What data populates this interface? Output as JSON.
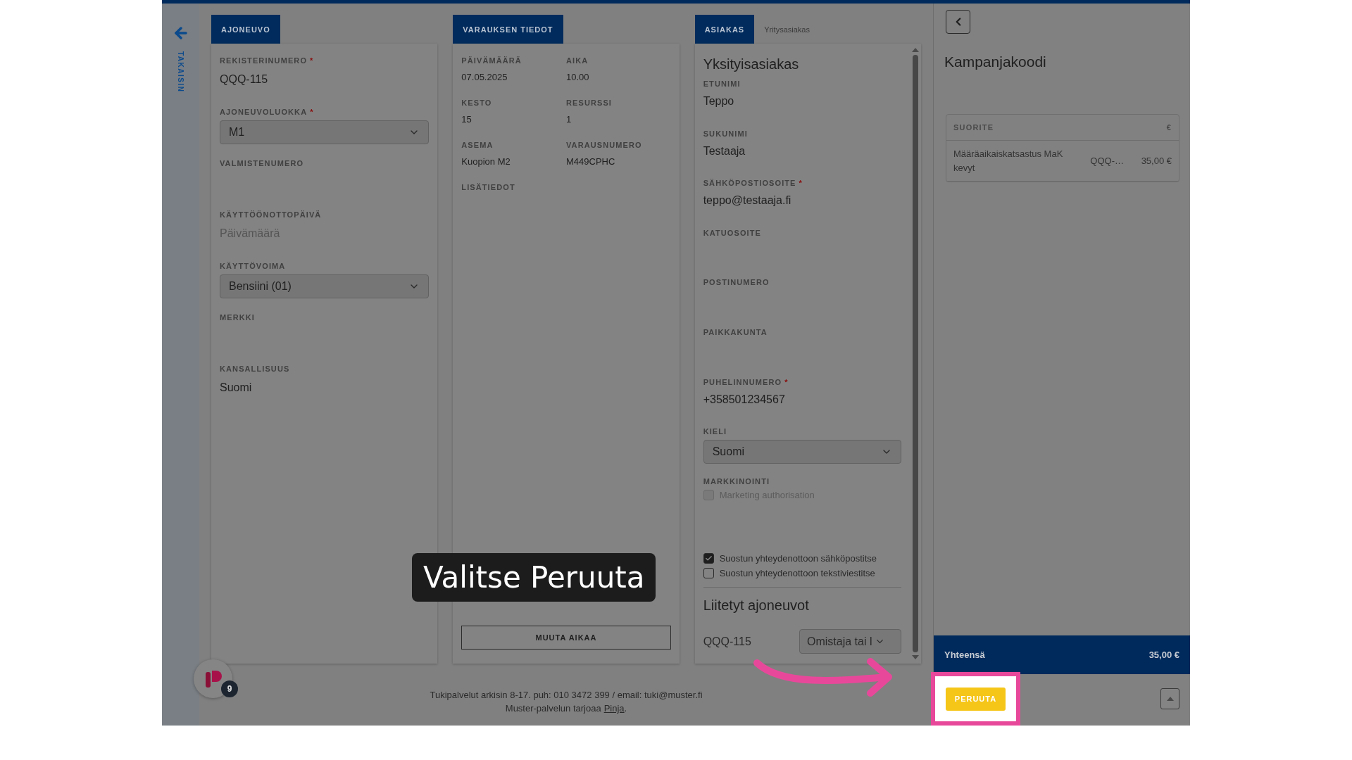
{
  "sidebar": {
    "back_label": "TAKAISIN"
  },
  "vehicle_panel": {
    "tab": "AJONEUVO",
    "fields": [
      {
        "kind": "text",
        "label": "REKISTERINUMERO",
        "mark": "*",
        "value": "QQQ-115"
      },
      {
        "kind": "select",
        "label": "AJONEUVOLUOKKA",
        "mark": "*",
        "value": "M1"
      },
      {
        "kind": "text",
        "label": "VALMISTENUMERO"
      },
      {
        "kind": "date",
        "label": "KÄYTTÖÖNOTTOPÄIVÄ",
        "placeholder": "Päivämäärä"
      },
      {
        "kind": "select",
        "label": "KÄYTTÖVOIMA",
        "value": "Bensiini (01)"
      },
      {
        "kind": "text",
        "label": "MERKKI"
      },
      {
        "kind": "text",
        "label": "KANSALLISUUS",
        "value": "Suomi"
      }
    ]
  },
  "booking_panel": {
    "tab": "VARAUKSEN TIEDOT",
    "fields": [
      {
        "label": "PÄIVÄMÄÄRÄ",
        "value": "07.05.2025"
      },
      {
        "label": "AIKA",
        "value": "10.00"
      },
      {
        "label": "KESTO",
        "value": "15"
      },
      {
        "label": "RESURSSI",
        "value": "1"
      },
      {
        "label": "ASEMA",
        "value": "Kuopion M2"
      },
      {
        "label": "VARAUSNUMERO",
        "value": "M449CPHC"
      },
      {
        "label": "LISÄTIEDOT"
      }
    ],
    "button": "MUUTA AIKAA"
  },
  "customer_panel": {
    "tabs": [
      {
        "label": "ASIAKAS",
        "selected": true
      },
      {
        "label": "Yritysasiakas",
        "selected": false
      }
    ],
    "heading": "Yksityisasiakas",
    "fields": [
      {
        "kind": "text",
        "label": "ETUNIMI",
        "value": "Teppo"
      },
      {
        "kind": "text",
        "label": "SUKUNIMI",
        "value": "Testaaja"
      },
      {
        "kind": "text",
        "label": "SÄHKÖPOSTIOSOITE",
        "mark": "*",
        "value": "teppo@testaaja.fi"
      },
      {
        "kind": "text",
        "label": "KATUOSOITE"
      },
      {
        "kind": "text",
        "label": "POSTINUMERO"
      },
      {
        "kind": "text",
        "label": "PAIKKAKUNTA"
      },
      {
        "kind": "text",
        "label": "PUHELINNUMERO",
        "mark": "*",
        "value": "+358501234567"
      },
      {
        "kind": "select",
        "label": "KIELI",
        "value": "Suomi"
      }
    ],
    "marketing": {
      "label": "MARKKINOINTI",
      "options": [
        {
          "label": "Marketing authorisation",
          "checked": false,
          "disabled": true
        }
      ]
    },
    "consents": [
      {
        "label": "Suostun yhteydenottoon sähköpostitse",
        "checked": true,
        "disabled": false
      },
      {
        "label": "Suostun yhteydenottoon tekstiviestitse",
        "checked": false,
        "disabled": false
      }
    ],
    "linked_heading": "Liitetyt ajoneuvot",
    "linked_vehicles": [
      {
        "plate": "QQQ-115",
        "role": "Omistaja tai l"
      }
    ]
  },
  "summary": {
    "heading": "Kampanjakoodi",
    "columns": [
      "SUORITE",
      "",
      "€"
    ],
    "rows": [
      {
        "cells": [
          "Määräaikaiskatsastus MaK kevyt",
          "QQQ-…",
          "35,00 €"
        ]
      }
    ],
    "total_label": "Yhteensä",
    "total_value": "35,00 €",
    "cancel": "PERUUTA"
  },
  "footer": {
    "support": "Tukipalvelut arkisin 8-17. puh: 010 3472 399 / email: tuki@muster.fi",
    "provider": "Muster-palvelun tarjoaa",
    "provider_link": "Pinja",
    "provider_end": "."
  },
  "launcher": {
    "badge": "9"
  },
  "tutorial": {
    "caption": "Valitse Peruuta"
  }
}
